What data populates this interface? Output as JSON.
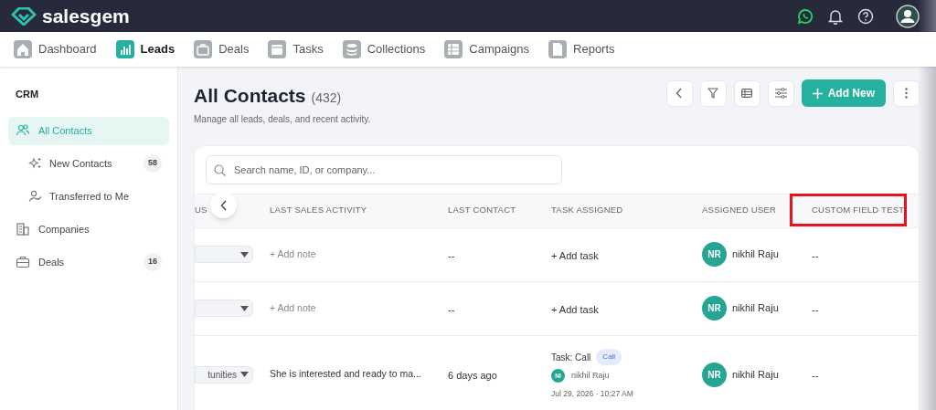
{
  "app": {
    "logo": "salesgem"
  },
  "nav_tabs": [
    {
      "label": "Dashboard",
      "selected": false
    },
    {
      "label": "Leads",
      "selected": true
    },
    {
      "label": "Deals",
      "selected": false
    },
    {
      "label": "Tasks",
      "selected": false
    },
    {
      "label": "Collections",
      "selected": false
    },
    {
      "label": "Campaigns",
      "selected": false
    },
    {
      "label": "Reports",
      "selected": false
    }
  ],
  "sidebar": {
    "heading": "CRM",
    "items": [
      {
        "label": "All Contacts",
        "kind": "main",
        "selected": true
      },
      {
        "label": "New Contacts",
        "kind": "sub",
        "selected": false,
        "count": "58"
      },
      {
        "label": "Transferred to Me",
        "kind": "sub",
        "selected": false
      },
      {
        "label": "Companies",
        "kind": "main",
        "selected": false
      },
      {
        "label": "Deals",
        "kind": "main",
        "selected": false,
        "count": "16"
      }
    ]
  },
  "page": {
    "title": "All Contacts",
    "count": "(432)",
    "subtitle": "Manage all leads, deals, and recent activity.",
    "add_button": "Add New"
  },
  "search": {
    "placeholder": "Search name, ID, or company..."
  },
  "table": {
    "columns": [
      {
        "label": "US",
        "highlighted": false
      },
      {
        "label": "LAST SALES ACTIVITY",
        "highlighted": false
      },
      {
        "label": "LAST CONTACT",
        "highlighted": false
      },
      {
        "label": "TASK ASSIGNED",
        "highlighted": false
      },
      {
        "label": "ASSIGNED USER",
        "highlighted": false
      },
      {
        "label": "CUSTOM FIELD TEST",
        "highlighted": true
      }
    ],
    "rows": [
      {
        "activity": "+ Add note",
        "activity_empty": true,
        "last_contact": "--",
        "task": {
          "kind": "add",
          "label": "+ Add task"
        },
        "user_initials": "NR",
        "user": "nikhil Raju",
        "custom": "--"
      },
      {
        "activity": "+ Add note",
        "activity_empty": true,
        "last_contact": "--",
        "task": {
          "kind": "add",
          "label": "+ Add task"
        },
        "user_initials": "NR",
        "user": "nikhil Raju",
        "custom": "--"
      },
      {
        "status": "tunities",
        "activity": "She is interested and ready to ma...",
        "activity_empty": false,
        "last_contact": "6 days ago",
        "task": {
          "kind": "task",
          "label": "Task: Call",
          "tag": "Call",
          "assignee_initials": "NI",
          "assignee": "nikhil Raju",
          "date": "Jul 29, 2026 · 10:27 AM"
        },
        "user_initials": "NR",
        "user": "nikhil Raju",
        "custom": "--"
      }
    ]
  }
}
